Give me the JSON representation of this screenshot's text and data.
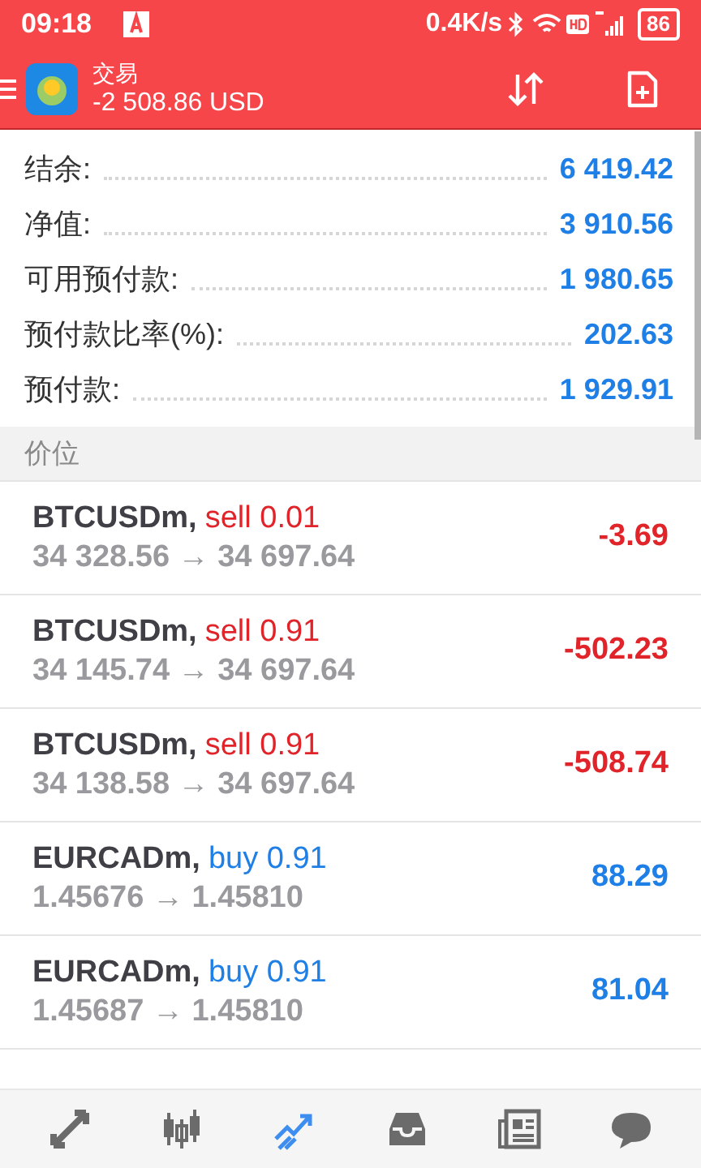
{
  "status_bar": {
    "time": "09:18",
    "speed": "0.4K/s",
    "battery": "86"
  },
  "header": {
    "title": "交易",
    "balance": "-2 508.86 USD"
  },
  "summary": [
    {
      "label": "结余:",
      "value": "6 419.42"
    },
    {
      "label": "净值:",
      "value": "3 910.56"
    },
    {
      "label": "可用预付款:",
      "value": "1 980.65"
    },
    {
      "label": "预付款比率(%):",
      "value": "202.63"
    },
    {
      "label": "预付款:",
      "value": "1 929.91"
    }
  ],
  "section_title": "价位",
  "positions": [
    {
      "symbol": "BTCUSDm,",
      "kind": "sell",
      "order": "sell 0.01",
      "prices": "34 328.56 → 34 697.64",
      "profit": "-3.69"
    },
    {
      "symbol": "BTCUSDm,",
      "kind": "sell",
      "order": "sell 0.91",
      "prices": "34 145.74 → 34 697.64",
      "profit": "-502.23"
    },
    {
      "symbol": "BTCUSDm,",
      "kind": "sell",
      "order": "sell 0.91",
      "prices": "34 138.58 → 34 697.64",
      "profit": "-508.74"
    },
    {
      "symbol": "EURCADm,",
      "kind": "buy",
      "order": "buy 0.91",
      "prices": "1.45676 → 1.45810",
      "profit": "88.29"
    },
    {
      "symbol": "EURCADm,",
      "kind": "buy",
      "order": "buy 0.91",
      "prices": "1.45687 → 1.45810",
      "profit": "81.04"
    }
  ],
  "nav": [
    {
      "kind": "quotes",
      "selected": false
    },
    {
      "kind": "chart",
      "selected": false
    },
    {
      "kind": "trade",
      "selected": true
    },
    {
      "kind": "history",
      "selected": false
    },
    {
      "kind": "news",
      "selected": false
    },
    {
      "kind": "chat",
      "selected": false
    }
  ]
}
